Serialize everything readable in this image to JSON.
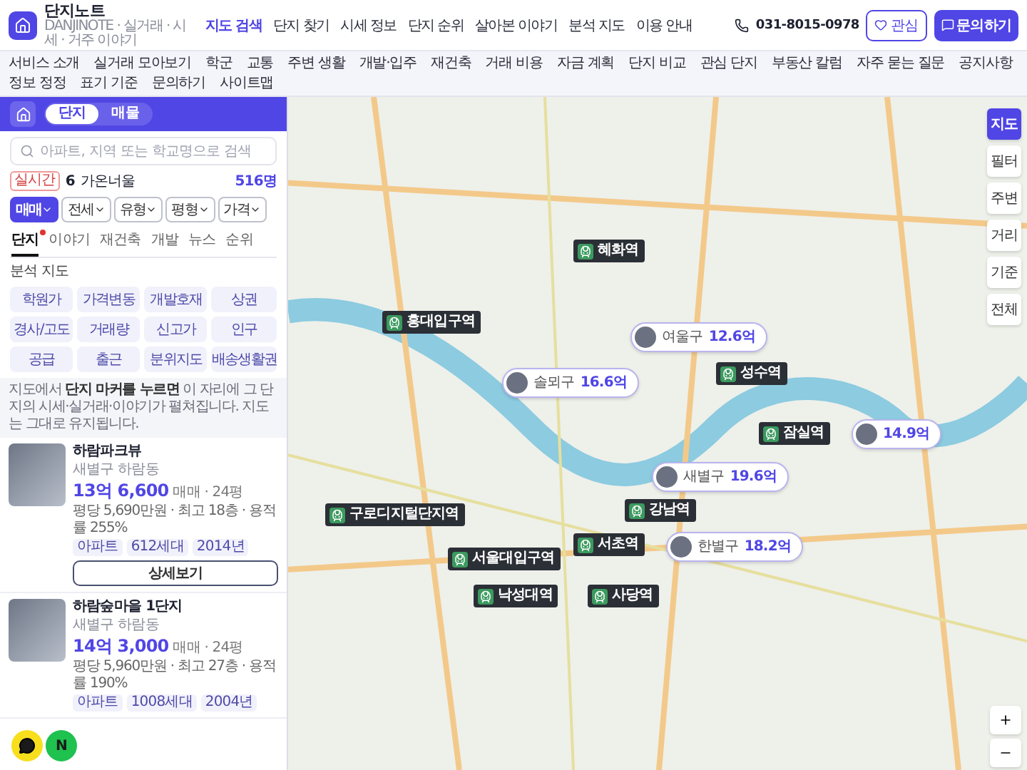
{
  "header": {
    "logo_name": "단지노트",
    "tagline": "DANJINOTE · 실거래 · 시세 · 거주 이야기",
    "nav": [
      {
        "label": "지도 검색",
        "selected": true
      },
      {
        "label": "단지 찾기",
        "selected": false
      },
      {
        "label": "시세 정보",
        "selected": false
      },
      {
        "label": "단지 순위",
        "selected": false
      },
      {
        "label": "살아본 이야기",
        "selected": false
      },
      {
        "label": "분석 지도",
        "selected": false
      },
      {
        "label": "이용 안내",
        "selected": false
      }
    ],
    "phone": "031-8015-0978",
    "favorite_button": "관심",
    "inquiry_button": "문의하기"
  },
  "subnav": [
    "서비스 소개",
    "실거래 모아보기",
    "학군",
    "교통",
    "주변 생활",
    "개발·입주",
    "재건축",
    "거래 비용",
    "자금 계획",
    "단지 비교",
    "관심 단지",
    "부동산 칼럼",
    "자주 묻는 질문",
    "공지사항",
    "정보 정정",
    "표기 기준",
    "문의하기",
    "사이트맵"
  ],
  "panel": {
    "toggle": [
      {
        "label": "단지",
        "selected": true
      },
      {
        "label": "매물",
        "selected": false
      }
    ],
    "search": {
      "placeholder": "아파트, 지역 또는 학교명으로 검색"
    },
    "live": {
      "badge": "실시간",
      "rank": "6",
      "name": "가온너울",
      "count": "516명"
    },
    "filters": [
      {
        "label": "매매",
        "selected": true
      },
      {
        "label": "전세",
        "selected": false
      },
      {
        "label": "유형",
        "selected": false
      },
      {
        "label": "평형",
        "selected": false
      },
      {
        "label": "가격",
        "selected": false
      }
    ],
    "tabs": [
      {
        "label": "단지",
        "selected": true,
        "dot": true
      },
      {
        "label": "이야기",
        "selected": false,
        "dot": false
      },
      {
        "label": "재건축",
        "selected": false,
        "dot": false
      },
      {
        "label": "개발",
        "selected": false,
        "dot": false
      },
      {
        "label": "뉴스",
        "selected": false,
        "dot": false
      },
      {
        "label": "순위",
        "selected": false,
        "dot": false
      }
    ],
    "section_title": "분석 지도",
    "analysis_items": [
      "학원가",
      "가격변동",
      "개발호재",
      "상권",
      "경사/고도",
      "거래량",
      "신고가",
      "인구",
      "공급",
      "출근",
      "분위지도",
      "배송생활권"
    ],
    "note": "지도에서 **단지 마커를 누르면** 이 자리에 그 단지의 시세·실거래·이야기가 펼쳐집니다. 지도는 그대로 유지됩니다.",
    "listings": [
      {
        "name": "하람파크뷰",
        "location": "새별구 하람동",
        "price": "13억 6,600",
        "deal": "매매 · 24평",
        "specs": "평당 5,690만원 · 최고 18층 · 용적률 255%",
        "tags": [
          "아파트",
          "612세대",
          "2014년"
        ],
        "button": "상세보기"
      },
      {
        "name": "하람숲마을 1단지",
        "location": "새별구 하람동",
        "price": "14억 3,000",
        "deal": "매매 · 24평",
        "specs": "평당 5,960만원 · 최고 27층 · 용적률 190%",
        "tags": [
          "아파트",
          "1008세대",
          "2004년"
        ]
      }
    ]
  },
  "map": {
    "markers": [
      {
        "kind": "station",
        "label": "혜화역"
      },
      {
        "kind": "station",
        "label": "홍대입구역"
      },
      {
        "kind": "price",
        "district": "여울구",
        "price": "12.6억"
      },
      {
        "kind": "station",
        "label": "성수역"
      },
      {
        "kind": "price",
        "district": "솔뫼구",
        "price": "16.6억"
      },
      {
        "kind": "station",
        "label": "잠실역"
      },
      {
        "kind": "price",
        "price": "14.9억"
      },
      {
        "kind": "price",
        "district": "새별구",
        "price": "19.6억"
      },
      {
        "kind": "station",
        "label": "강남역"
      },
      {
        "kind": "station",
        "label": "서초역"
      },
      {
        "kind": "price",
        "district": "한별구",
        "price": "18.2억"
      },
      {
        "kind": "station",
        "label": "구로디지털단지역"
      },
      {
        "kind": "station",
        "label": "서울대입구역"
      },
      {
        "kind": "station",
        "label": "낙성대역"
      },
      {
        "kind": "station",
        "label": "사당역"
      }
    ],
    "controls": [
      {
        "label": "지도",
        "selected": true
      },
      {
        "label": "필터",
        "selected": false
      },
      {
        "label": "주변",
        "selected": false
      },
      {
        "label": "거리",
        "selected": false
      },
      {
        "label": "기준",
        "selected": false
      },
      {
        "label": "전체",
        "selected": false
      }
    ]
  },
  "chat": {
    "naver_label": "N"
  }
}
